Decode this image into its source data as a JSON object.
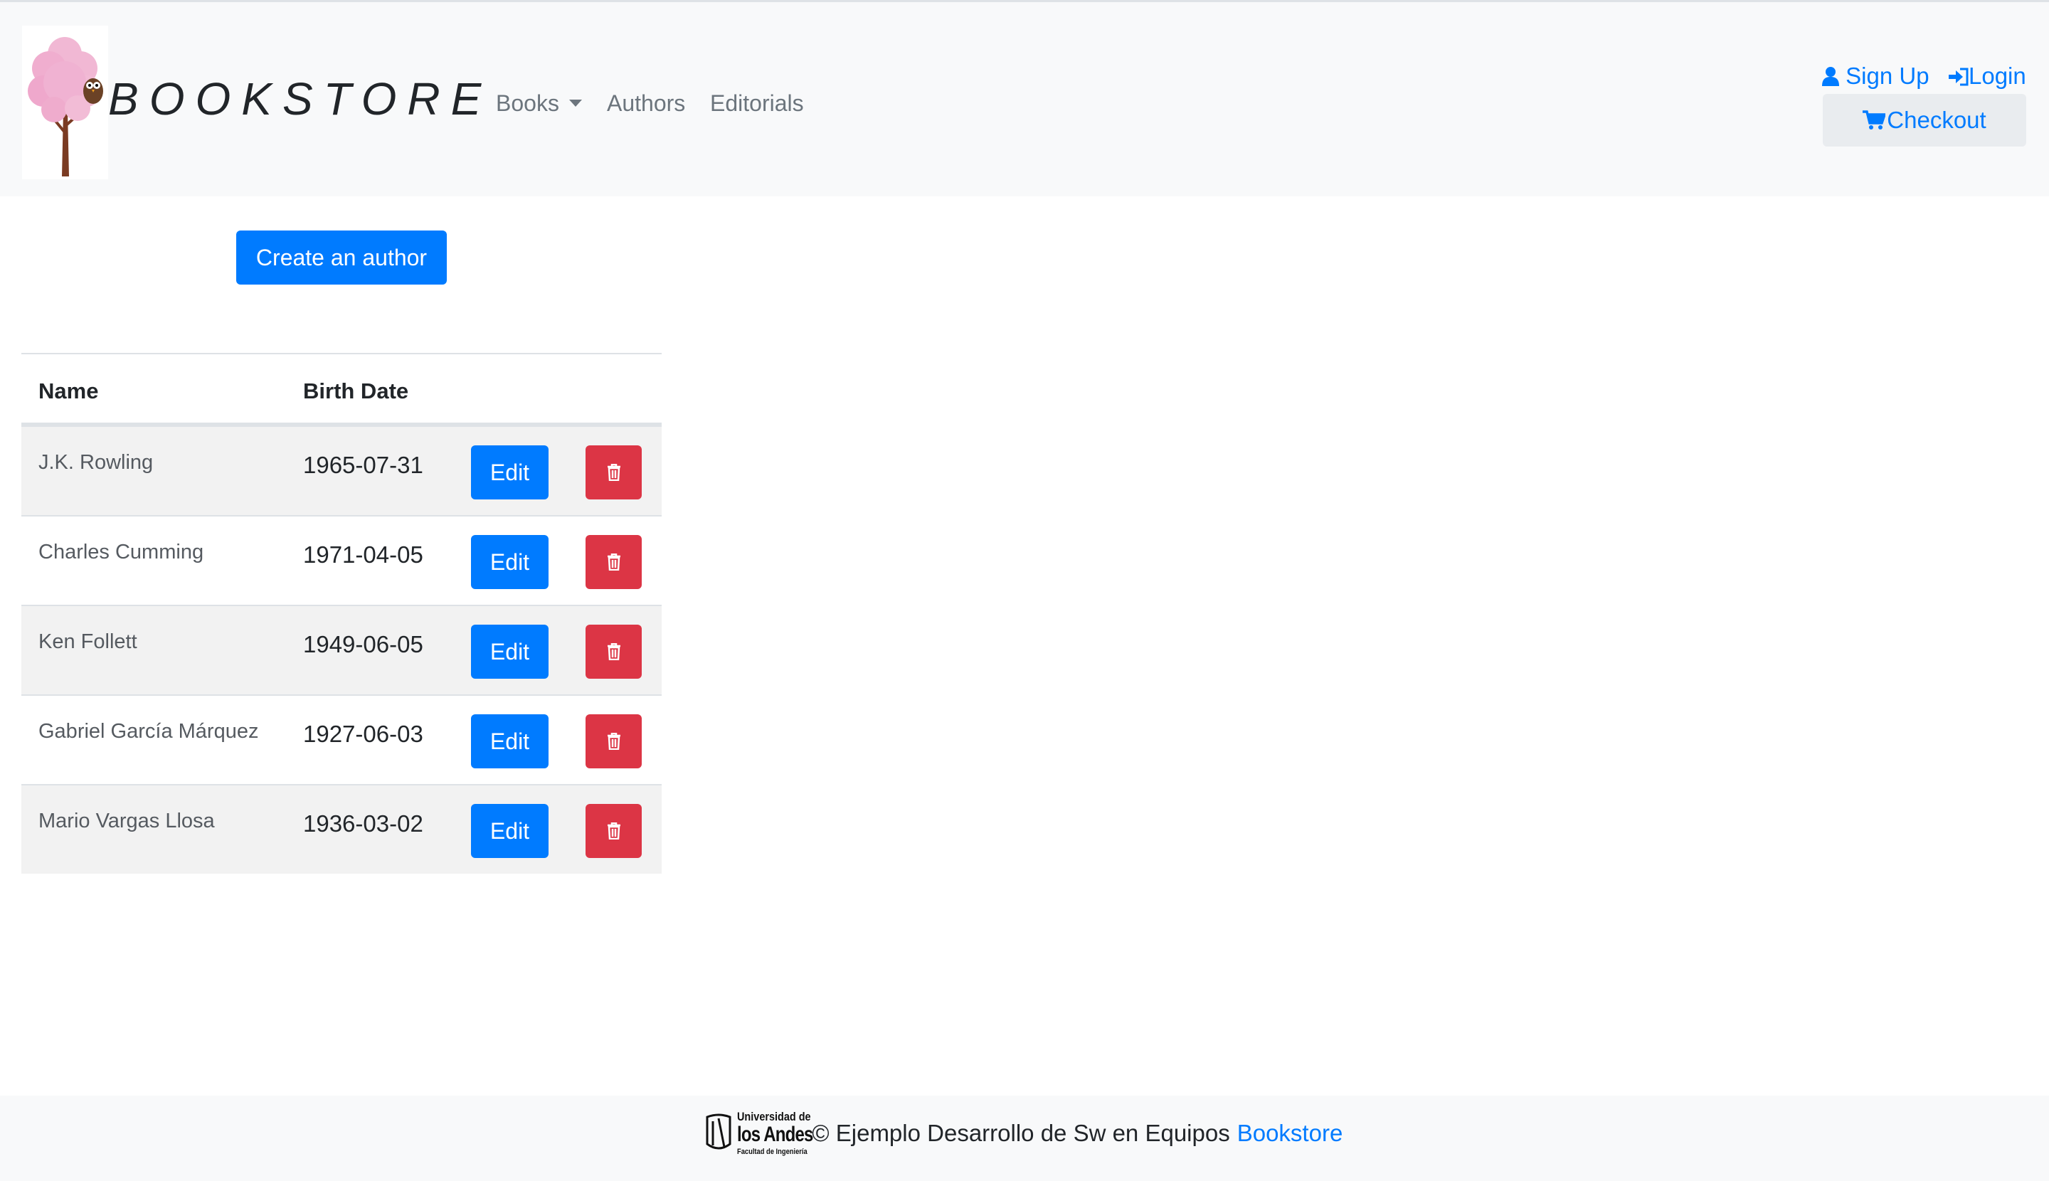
{
  "header": {
    "brand": "BOOKSTORE",
    "nav": {
      "books": "Books",
      "authors": "Authors",
      "editorials": "Editorials"
    },
    "signup": "Sign Up",
    "login": "Login",
    "checkout": "Checkout"
  },
  "main": {
    "create_button": "Create an author",
    "columns": {
      "name": "Name",
      "birth_date": "Birth Date"
    },
    "edit_label": "Edit",
    "rows": [
      {
        "name": "J.K. Rowling",
        "birth_date": "1965-07-31"
      },
      {
        "name": "Charles Cumming",
        "birth_date": "1971-04-05"
      },
      {
        "name": "Ken Follett",
        "birth_date": "1949-06-05"
      },
      {
        "name": "Gabriel García Márquez",
        "birth_date": "1927-06-03"
      },
      {
        "name": "Mario Vargas Llosa",
        "birth_date": "1936-03-02"
      }
    ]
  },
  "footer": {
    "logo_line1": "Universidad de",
    "logo_line2": "los Andes",
    "logo_line3": "Facultad de Ingeniería",
    "text": "© Ejemplo Desarrollo de Sw en Equipos",
    "link": "Bookstore"
  },
  "colors": {
    "primary": "#007bff",
    "danger": "#dc3545",
    "navbar_bg": "#f8f9fa",
    "stripe": "#f2f2f2"
  }
}
